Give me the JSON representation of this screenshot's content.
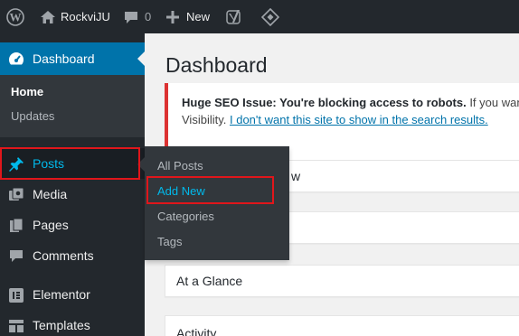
{
  "admin_bar": {
    "site_name": "RockviJU",
    "comments_count": "0",
    "new_label": "New",
    "icons": [
      "wordpress-logo-icon",
      "home-icon",
      "comment-bubble-icon",
      "plus-icon",
      "yoast-icon",
      "diamond-plugin-icon"
    ]
  },
  "sidebar": {
    "dashboard_label": "Dashboard",
    "dashboard_submenu": [
      {
        "label": "Home"
      },
      {
        "label": "Updates"
      }
    ],
    "items": [
      {
        "label": "Posts",
        "icon": "pin-icon"
      },
      {
        "label": "Media",
        "icon": "media-icon"
      },
      {
        "label": "Pages",
        "icon": "pages-icon"
      },
      {
        "label": "Comments",
        "icon": "comments-icon"
      },
      {
        "label": "Elementor",
        "icon": "elementor-icon"
      },
      {
        "label": "Templates",
        "icon": "templates-icon"
      }
    ]
  },
  "flyout": {
    "items": [
      {
        "label": "All Posts"
      },
      {
        "label": "Add New"
      },
      {
        "label": "Categories"
      },
      {
        "label": "Tags"
      }
    ]
  },
  "main": {
    "title": "Dashboard",
    "notice": {
      "bold": "Huge SEO Issue: You're blocking access to robots.",
      "rest": " If you want se",
      "line2_prefix": "Visibility. ",
      "link": "I don't want this site to show in the search results."
    },
    "boxes": [
      {
        "title": "w"
      },
      {
        "title": ""
      },
      {
        "title": "At a Glance"
      },
      {
        "title": "Activity"
      }
    ]
  },
  "colors": {
    "adminbar_bg": "#23282d",
    "active_menu": "#0073aa",
    "hover_text": "#00b9eb",
    "highlight_red": "#e0161b",
    "notice_red": "#dc3232"
  }
}
